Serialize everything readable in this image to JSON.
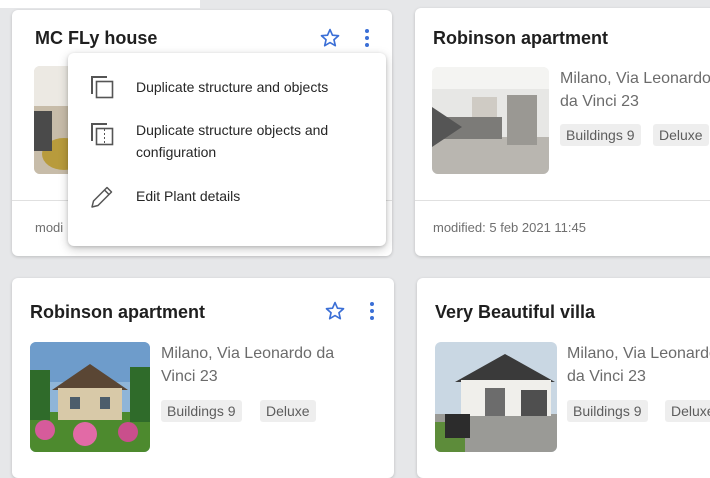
{
  "cards": [
    {
      "title": "MC FLy house",
      "modified": "modi"
    },
    {
      "title": "Robinson apartment",
      "address": "Milano, Via Leonardo da Vinci 23",
      "tags": [
        "Buildings 9",
        "Deluxe"
      ],
      "modified": "modified: 5 feb 2021 11:45"
    },
    {
      "title": "Robinson apartment",
      "address": "Milano, Via Leonardo da Vinci 23",
      "tags": [
        "Buildings 9",
        "Deluxe"
      ]
    },
    {
      "title": "Very Beautiful villa",
      "address": "Milano, Via Leonardo da Vinci 23",
      "tags": [
        "Buildings 9",
        "Deluxe"
      ]
    }
  ],
  "menu": {
    "items": [
      {
        "label": "Duplicate structure and objects",
        "icon": "copy-icon"
      },
      {
        "label": "Duplicate structure objects and configuration",
        "icon": "copy-config-icon"
      },
      {
        "label": "Edit Plant details",
        "icon": "pencil-icon"
      }
    ]
  },
  "colors": {
    "accent": "#3b6fd6",
    "background": "#e6e7e9"
  }
}
